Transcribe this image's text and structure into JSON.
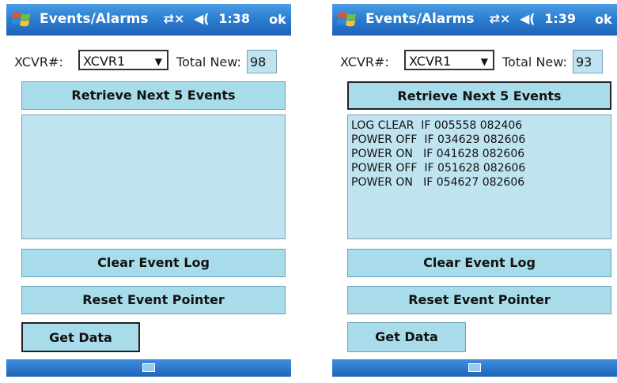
{
  "screens": [
    {
      "title": "Events/Alarms",
      "status": {
        "connectivity": "⇄×",
        "volume": "◀(",
        "time": "1:38"
      },
      "ok_label": "ok",
      "xcvr_label": "XCVR#:",
      "xcvr_value": "XCVR1",
      "total_new_label": "Total New:",
      "total_new_value": "98",
      "retrieve_label": "Retrieve Next 5 Events",
      "events": [
        "",
        "",
        "",
        "",
        ""
      ],
      "clear_label": "Clear Event Log",
      "reset_label": "Reset Event Pointer",
      "get_data_label": "Get Data"
    },
    {
      "title": "Events/Alarms",
      "status": {
        "connectivity": "⇄×",
        "volume": "◀(",
        "time": "1:39"
      },
      "ok_label": "ok",
      "xcvr_label": "XCVR#:",
      "xcvr_value": "XCVR1",
      "total_new_label": "Total New:",
      "total_new_value": "93",
      "retrieve_label": "Retrieve Next 5 Events",
      "events": [
        "LOG CLEAR  IF 005558 082406",
        "POWER OFF  IF 034629 082606",
        "POWER ON   IF 041628 082606",
        "POWER OFF  IF 051628 082606",
        "POWER ON   IF 054627 082606"
      ],
      "clear_label": "Clear Event Log",
      "reset_label": "Reset Event Pointer",
      "get_data_label": "Get Data"
    }
  ]
}
